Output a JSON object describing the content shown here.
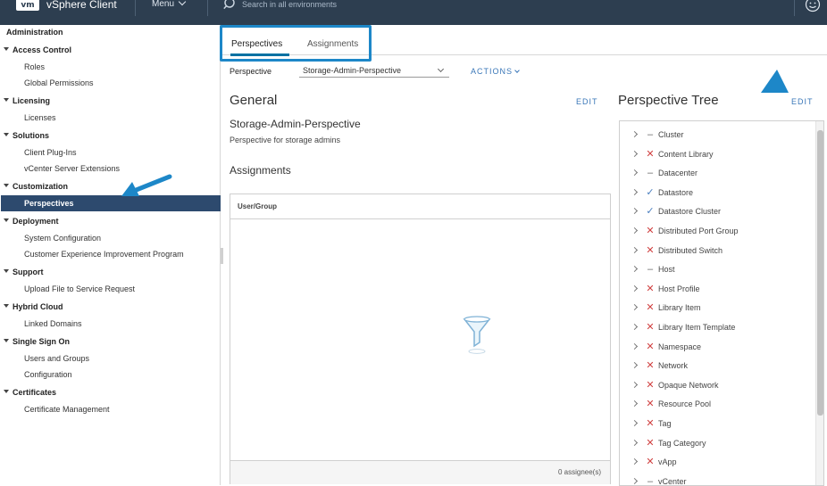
{
  "topbar": {
    "logo": "vm",
    "app_title": "vSphere Client",
    "menu_label": "Menu",
    "search_placeholder": "Search in all environments"
  },
  "sidebar": {
    "title": "Administration",
    "groups": [
      {
        "label": "Access Control",
        "items": [
          "Roles",
          "Global Permissions"
        ]
      },
      {
        "label": "Licensing",
        "items": [
          "Licenses"
        ]
      },
      {
        "label": "Solutions",
        "items": [
          "Client Plug-Ins",
          "vCenter Server Extensions"
        ]
      },
      {
        "label": "Customization",
        "items": [
          "Perspectives"
        ]
      },
      {
        "label": "Deployment",
        "items": [
          "System Configuration",
          "Customer Experience Improvement Program"
        ]
      },
      {
        "label": "Support",
        "items": [
          "Upload File to Service Request"
        ]
      },
      {
        "label": "Hybrid Cloud",
        "items": [
          "Linked Domains"
        ]
      },
      {
        "label": "Single Sign On",
        "items": [
          "Users and Groups",
          "Configuration"
        ]
      },
      {
        "label": "Certificates",
        "items": [
          "Certificate Management"
        ]
      }
    ],
    "active_item": "Perspectives"
  },
  "main": {
    "tabs": [
      {
        "label": "Perspectives",
        "active": true
      },
      {
        "label": "Assignments",
        "active": false
      }
    ],
    "perspective_label": "Perspective",
    "perspective_value": "Storage-Admin-Perspective",
    "actions_label": "ACTIONS",
    "general": {
      "title": "General",
      "edit_label": "EDIT",
      "name": "Storage-Admin-Perspective",
      "description": "Perspective for storage admins"
    },
    "assignments": {
      "title": "Assignments",
      "column_header": "User/Group",
      "footer": "0 assignee(s)"
    },
    "tree": {
      "title": "Perspective Tree",
      "edit_label": "EDIT",
      "items": [
        {
          "label": "Cluster",
          "state": "dash"
        },
        {
          "label": "Content Library",
          "state": "x"
        },
        {
          "label": "Datacenter",
          "state": "dash"
        },
        {
          "label": "Datastore",
          "state": "check"
        },
        {
          "label": "Datastore Cluster",
          "state": "check"
        },
        {
          "label": "Distributed Port Group",
          "state": "x"
        },
        {
          "label": "Distributed Switch",
          "state": "x"
        },
        {
          "label": "Host",
          "state": "dash"
        },
        {
          "label": "Host Profile",
          "state": "x"
        },
        {
          "label": "Library Item",
          "state": "x"
        },
        {
          "label": "Library Item Template",
          "state": "x"
        },
        {
          "label": "Namespace",
          "state": "x"
        },
        {
          "label": "Network",
          "state": "x"
        },
        {
          "label": "Opaque Network",
          "state": "x"
        },
        {
          "label": "Resource Pool",
          "state": "x"
        },
        {
          "label": "Tag",
          "state": "x"
        },
        {
          "label": "Tag Category",
          "state": "x"
        },
        {
          "label": "vApp",
          "state": "x"
        },
        {
          "label": "vCenter",
          "state": "dash"
        }
      ]
    }
  },
  "colors": {
    "topbar": "#2d3e50",
    "active_item": "#2d4a6e",
    "accent": "#1d87c8",
    "link": "#3a77b8",
    "deny": "#d04040",
    "allow": "#4a7fbf"
  }
}
